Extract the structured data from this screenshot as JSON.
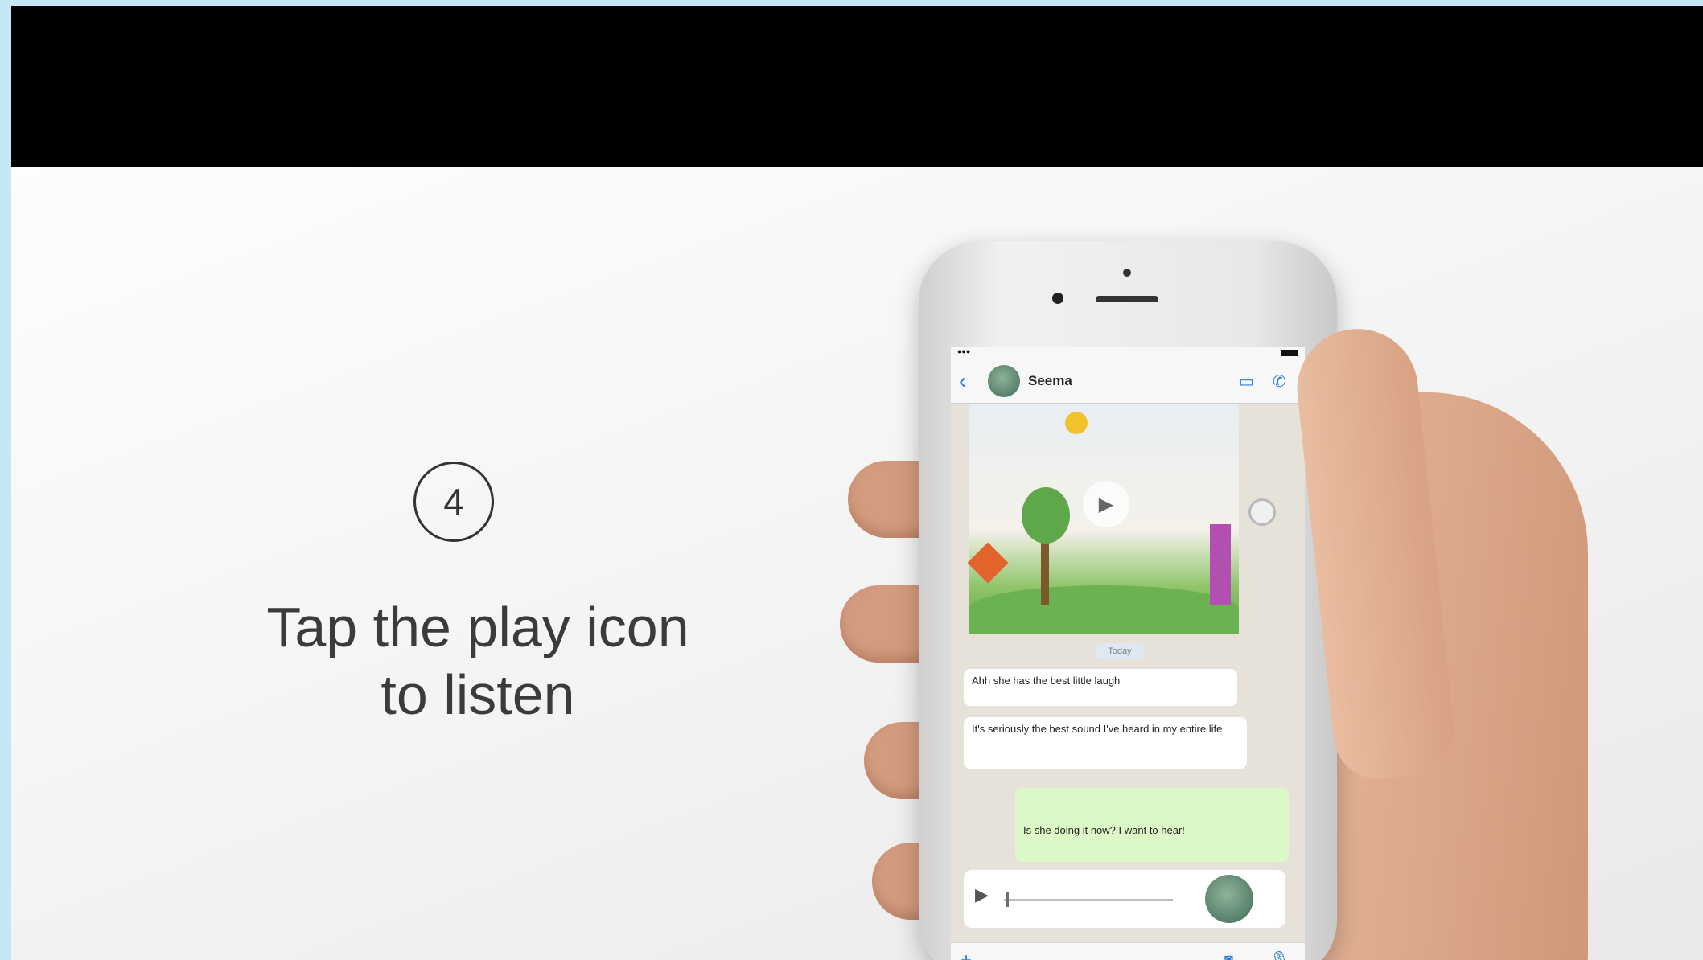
{
  "step": {
    "number": "4",
    "text_line1": "Tap the play icon",
    "text_line2": "to listen"
  },
  "chat": {
    "contact_name": "Seema",
    "date_chip": "Today",
    "messages": [
      {
        "text": "Ahh she has the best little laugh",
        "direction": "incoming"
      },
      {
        "text": "It's seriously the best sound I've heard in my entire life",
        "direction": "incoming"
      },
      {
        "text": "Is she doing it now? I want to hear!",
        "direction": "outgoing"
      }
    ]
  },
  "colors": {
    "top_bar": "#000000",
    "outgoing_bubble": "#dcf8c6",
    "accent": "#2a7fd9"
  }
}
